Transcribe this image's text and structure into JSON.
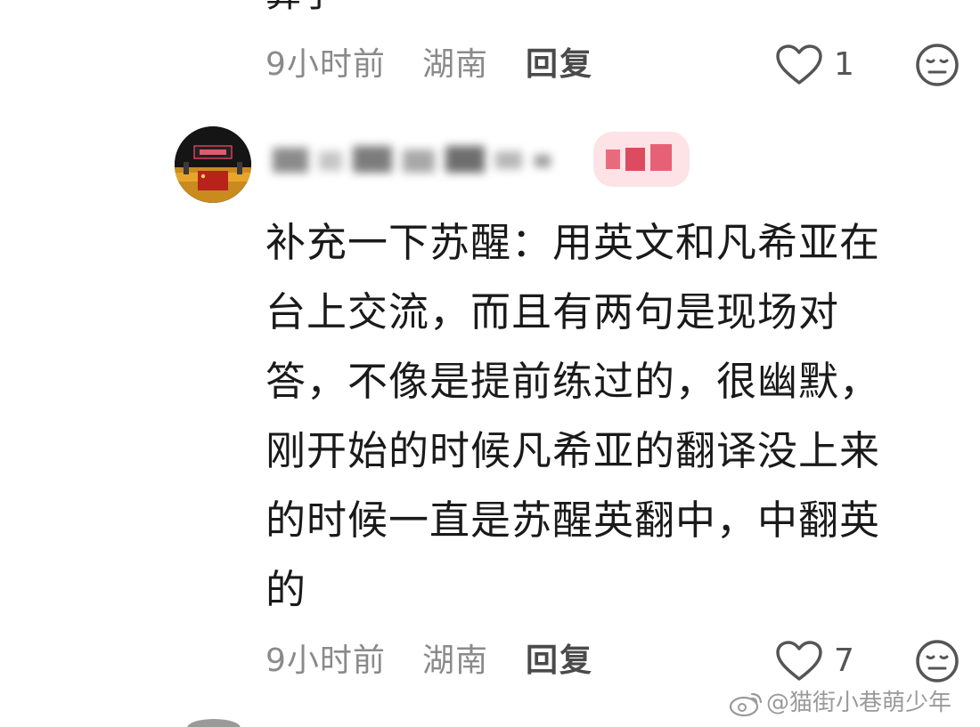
{
  "previous_comment": {
    "cut_text": "算了",
    "time": "9小时前",
    "location": "湖南",
    "reply_label": "回复",
    "like_count": "1"
  },
  "comment": {
    "username": "",
    "lines": [
      "补充一下苏醒：用英文和凡希亚在",
      "台上交流，而且有两句是现场对",
      "答，不像是提前练过的，很幽默，",
      "刚开始的时候凡希亚的翻译没上来",
      "的时候一直是苏醒英翻中，中翻英",
      "的"
    ],
    "time": "9小时前",
    "location": "湖南",
    "reply_label": "回复",
    "like_count": "7"
  },
  "watermark": {
    "text": "@猫街小巷萌少年"
  },
  "icons": {
    "like": "heart-outline-icon",
    "dislike": "meh-face-icon",
    "watermark": "weibo-logo-icon"
  },
  "colors": {
    "meta_text": "#8a8a8a",
    "reply_text": "#4a4a4a",
    "body_text": "#1a1a1a",
    "badge_bg": "#fde3e6"
  }
}
